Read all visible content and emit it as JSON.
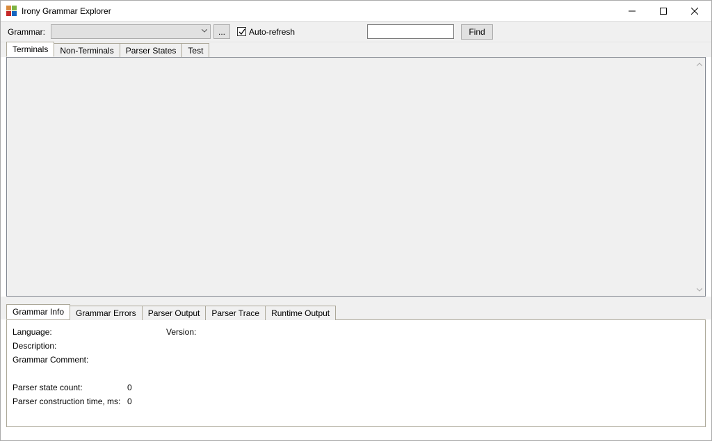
{
  "window": {
    "title": "Irony Grammar Explorer"
  },
  "toolbar": {
    "grammar_label": "Grammar:",
    "browse_label": "...",
    "autorefresh_label": "Auto-refresh",
    "find_label": "Find",
    "search_value": ""
  },
  "tabs_top": [
    {
      "label": "Terminals",
      "active": true
    },
    {
      "label": "Non-Terminals",
      "active": false
    },
    {
      "label": "Parser States",
      "active": false
    },
    {
      "label": "Test",
      "active": false
    }
  ],
  "tabs_bottom": [
    {
      "label": "Grammar Info",
      "active": true
    },
    {
      "label": "Grammar Errors",
      "active": false
    },
    {
      "label": "Parser Output",
      "active": false
    },
    {
      "label": "Parser Trace",
      "active": false
    },
    {
      "label": "Runtime Output",
      "active": false
    }
  ],
  "info": {
    "language_label": "Language:",
    "language_value": "",
    "version_label": "Version:",
    "version_value": "",
    "description_label": "Description:",
    "description_value": "",
    "comment_label": "Grammar Comment:",
    "comment_value": "",
    "state_count_label": "Parser state count:",
    "state_count_value": "0",
    "construction_time_label": "Parser construction time, ms:",
    "construction_time_value": "0"
  }
}
